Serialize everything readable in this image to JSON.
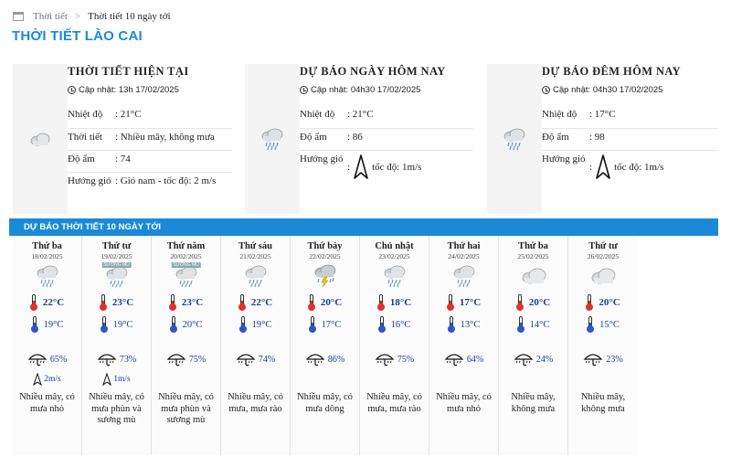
{
  "breadcrumb": {
    "home": "Thời tiết",
    "separator": ">",
    "current": "Thời tiết 10 ngày tới"
  },
  "page_title": "THỜI TIẾT LÀO CAI",
  "current": {
    "title": "THỜI TIẾT HIỆN TẠI",
    "update": "Cập nhật: 13h 17/02/2025",
    "icon": "cloudy-icon",
    "rows": [
      {
        "label": "Nhiệt độ",
        "value": ": 21°C"
      },
      {
        "label": "Thời tiết",
        "value": ": Nhiều mây, không mưa"
      },
      {
        "label": "Độ ẩm",
        "value": ": 74"
      },
      {
        "label": "Hướng gió",
        "value": ": Gió nam - tốc độ: 2 m/s"
      }
    ]
  },
  "today": {
    "title": "DỰ BÁO NGÀY HÔM NAY",
    "update": "Cập nhật: 04h30 17/02/2025",
    "icon": "rain-cloud-icon",
    "rows": [
      {
        "label": "Nhiệt độ",
        "value": ": 21°C"
      },
      {
        "label": "Độ ẩm",
        "value": ": 86"
      },
      {
        "label": "Hướng gió",
        "colon": ":",
        "value": "tốc độ: 1m/s"
      }
    ]
  },
  "tonight": {
    "title": "DỰ BÁO ĐÊM HÔM NAY",
    "update": "Cập nhật: 04h30 17/02/2025",
    "icon": "rain-cloud-icon",
    "rows": [
      {
        "label": "Nhiệt độ",
        "value": ": 17°C"
      },
      {
        "label": "Độ ẩm",
        "value": ": 98"
      },
      {
        "label": "Hướng gió",
        "colon": ":",
        "value": "tốc độ: 1m/s"
      }
    ]
  },
  "ten_day": {
    "title": "DỰ BÁO THỜI TIẾT 10 NGÀY TỚI",
    "days": [
      {
        "name": "Thứ ba",
        "date": "18/02/2025",
        "icon": "rain-cloud-icon",
        "badge": "",
        "hi": "22°C",
        "lo": "19°C",
        "rain": "65%",
        "wind": "2m/s",
        "desc": "Nhiều mây, có mưa nhỏ"
      },
      {
        "name": "Thứ tư",
        "date": "19/02/2025",
        "icon": "rain-fog-icon",
        "badge": "SƯƠNG MÙ",
        "hi": "23°C",
        "lo": "19°C",
        "rain": "73%",
        "wind": "1m/s",
        "desc": "Nhiều mây, có mưa phùn và sương mù"
      },
      {
        "name": "Thứ năm",
        "date": "20/02/2025",
        "icon": "rain-fog-icon",
        "badge": "SƯƠNG MÙ",
        "hi": "23°C",
        "lo": "20°C",
        "rain": "75%",
        "wind": "",
        "desc": "Nhiều mây, có mưa phùn và sương mù"
      },
      {
        "name": "Thứ sáu",
        "date": "21/02/2025",
        "icon": "rain-cloud-icon",
        "badge": "",
        "hi": "22°C",
        "lo": "19°C",
        "rain": "74%",
        "wind": "",
        "desc": "Nhiều mây, có mưa, mưa rào"
      },
      {
        "name": "Thứ bảy",
        "date": "22/02/2025",
        "icon": "thunderstorm-icon",
        "badge": "",
        "hi": "20°C",
        "lo": "17°C",
        "rain": "86%",
        "wind": "",
        "desc": "Nhiều mây, có mưa dông"
      },
      {
        "name": "Chủ nhật",
        "date": "23/02/2025",
        "icon": "rain-cloud-icon",
        "badge": "",
        "hi": "18°C",
        "lo": "16°C",
        "rain": "75%",
        "wind": "",
        "desc": "Nhiều mây, có mưa, mưa rào"
      },
      {
        "name": "Thứ hai",
        "date": "24/02/2025",
        "icon": "rain-cloud-icon",
        "badge": "",
        "hi": "17°C",
        "lo": "13°C",
        "rain": "64%",
        "wind": "",
        "desc": "Nhiều mây, có mưa nhỏ"
      },
      {
        "name": "Thứ ba",
        "date": "25/02/2025",
        "icon": "cloudy-icon",
        "badge": "",
        "hi": "20°C",
        "lo": "14°C",
        "rain": "24%",
        "wind": "",
        "desc": "Nhiều mây, không mưa"
      },
      {
        "name": "Thứ tư",
        "date": "26/02/2025",
        "icon": "cloudy-icon",
        "badge": "",
        "hi": "20°C",
        "lo": "15°C",
        "rain": "23%",
        "wind": "",
        "desc": "Nhiều mây, không mưa"
      }
    ]
  },
  "colors": {
    "accent": "#1a8ad8",
    "temp_text": "#1a3b9a",
    "hot": "#e03030",
    "cold": "#2a58c8"
  }
}
